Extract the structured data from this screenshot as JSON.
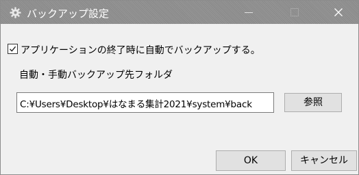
{
  "window": {
    "title": "バックアップ設定",
    "icon": "gear-icon",
    "controls": [
      "minimize-icon",
      "maximize-icon",
      "close-icon"
    ]
  },
  "backup_option": {
    "label": "アプリケーションの終了時に自動でバックアップする。",
    "checked": true
  },
  "folder": {
    "label": "自動・手動バックアップ先フォルダ",
    "path": "C:¥Users¥Desktop¥はなまる集計2021¥system¥back"
  },
  "buttons": {
    "browse_label": "参照",
    "ok_label": "OK",
    "cancel_label": "キャンセル"
  },
  "colors": {
    "titlebar": "#8f8f8f",
    "dialog_background": "#f0f0f0",
    "button_face": "#e1e1e1",
    "page_background": "#f6dede"
  }
}
